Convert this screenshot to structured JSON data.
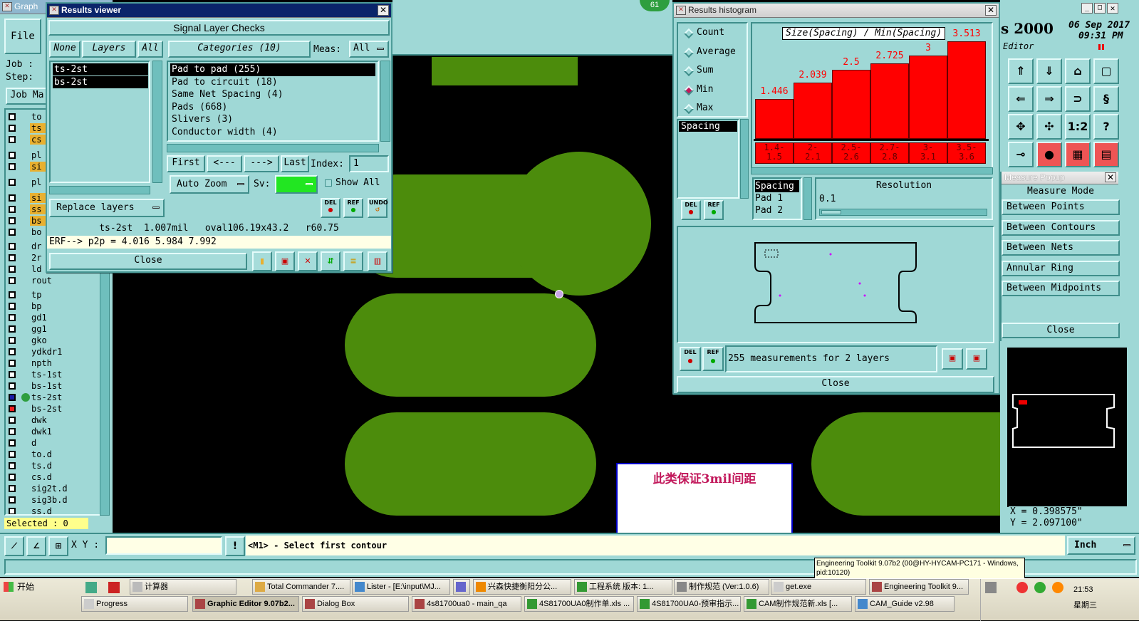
{
  "graphic_editor": {
    "title": "Graph",
    "file_menu": "File",
    "job_label": "Job :",
    "step_label": "Step:",
    "job_manager_btn": "Job Ma",
    "right_header_num": "s 2000",
    "right_header_date": "06 Sep 2017",
    "right_header_time": "09:31 PM",
    "editor_label": "Editor",
    "badge": "61"
  },
  "layers": [
    {
      "name": "to",
      "color": "#9fd8d6"
    },
    {
      "name": "ts",
      "color": "#e8b030"
    },
    {
      "name": "cs",
      "color": "#e8b030"
    },
    {
      "name": "pl",
      "color": "#9fd8d6"
    },
    {
      "name": "si",
      "color": "#e8b030"
    },
    {
      "name": "pl",
      "color": "#9fd8d6"
    },
    {
      "name": "si",
      "color": "#e8b030"
    },
    {
      "name": "ss",
      "color": "#e8b030"
    },
    {
      "name": "bs",
      "color": "#e8b030"
    },
    {
      "name": "bo",
      "color": "#9fd8d6"
    },
    {
      "name": "dr",
      "color": "#9fd8d6"
    },
    {
      "name": "2r",
      "color": "#9fd8d6"
    },
    {
      "name": "ld",
      "color": "#9fd8d6"
    },
    {
      "name": "rout",
      "color": "#9fd8d6"
    },
    {
      "name": "tp",
      "color": "#9fd8d6"
    },
    {
      "name": "bp",
      "color": "#9fd8d6"
    },
    {
      "name": "gd1",
      "color": "#9fd8d6"
    },
    {
      "name": "gg1",
      "color": "#9fd8d6"
    },
    {
      "name": "gko",
      "color": "#9fd8d6"
    },
    {
      "name": "ydkdr1",
      "color": "#9fd8d6"
    },
    {
      "name": "npth",
      "color": "#9fd8d6"
    },
    {
      "name": "ts-1st",
      "color": "#9fd8d6"
    },
    {
      "name": "bs-1st",
      "color": "#9fd8d6"
    },
    {
      "name": "ts-2st",
      "color": "#9fd8d6"
    },
    {
      "name": "bs-2st",
      "color": "#9fd8d6"
    },
    {
      "name": "dwk",
      "color": "#9fd8d6"
    },
    {
      "name": "dwk1",
      "color": "#9fd8d6"
    },
    {
      "name": "d",
      "color": "#9fd8d6"
    },
    {
      "name": "to.d",
      "color": "#9fd8d6"
    },
    {
      "name": "ts.d",
      "color": "#9fd8d6"
    },
    {
      "name": "cs.d",
      "color": "#9fd8d6"
    },
    {
      "name": "sig2t.d",
      "color": "#9fd8d6"
    },
    {
      "name": "sig3b.d",
      "color": "#9fd8d6"
    },
    {
      "name": "ss.d",
      "color": "#9fd8d6"
    }
  ],
  "selected_label": "Selected : 0",
  "results_viewer": {
    "title": "Results viewer",
    "header": "Signal Layer Checks",
    "none_btn": "None",
    "layers_btn": "Layers",
    "all_btn": "All",
    "categories_label": "Categories (10)",
    "meas_label": "Meas:",
    "meas_value": "All",
    "layer_items": [
      "ts-2st",
      "bs-2st"
    ],
    "category_items": [
      "Pad to pad (255)",
      "Pad to circuit (18)",
      "Same Net Spacing (4)",
      "Pads (668)",
      "Slivers (3)",
      "Conductor width (4)"
    ],
    "first_btn": "First",
    "prev_btn": "<---",
    "next_btn": "--->",
    "last_btn": "Last",
    "index_label": "Index:",
    "index_value": "1",
    "auto_zoom": "Auto Zoom",
    "sv_label": "Sv:",
    "show_all": "Show All",
    "replace_layers": "Replace layers",
    "del": "DEL",
    "ref": "REF",
    "undo": "UNDO",
    "info_line": "ts-2st  1.007mil   oval106.19x43.2   r60.75",
    "erf_line": "ERF--> p2p = 4.016 5.984 7.992",
    "close": "Close"
  },
  "histogram": {
    "title": "Results histogram",
    "modes": [
      {
        "label": "Count",
        "on": false
      },
      {
        "label": "Average",
        "on": false
      },
      {
        "label": "Sum",
        "on": false
      },
      {
        "label": "Min",
        "on": true
      },
      {
        "label": "Max",
        "on": false
      }
    ],
    "list_item": "Spacing",
    "chart_title": "Size(Spacing) / Min(Spacing)",
    "chart_data": {
      "type": "bar",
      "categories": [
        "1.4-1.5",
        "2-2.1",
        "2.5-2.6",
        "2.7-2.8",
        "3-3.1",
        "3.5-3.6"
      ],
      "values": [
        1.446,
        2.039,
        2.5,
        2.725,
        3,
        3.513
      ],
      "value_labels": [
        "1.446",
        "2.039",
        "2.5",
        "2.725",
        "3",
        "3.513"
      ],
      "bin_line1": [
        "1.4-",
        "2-",
        "2.5-",
        "2.7-",
        "3-",
        "3.5-"
      ],
      "bin_line2": [
        "1.5",
        "2.1",
        "2.6",
        "2.8",
        "3.1",
        "3.6"
      ],
      "ylim": [
        0,
        3.6
      ]
    },
    "info_list": [
      "Spacing",
      "Pad 1",
      "Pad 2"
    ],
    "resolution_label": "Resolution",
    "resolution_value": "0.1",
    "measurements": "255 measurements for 2 layers",
    "close": "Close"
  },
  "measure_popup": {
    "title": "Measure Popup",
    "mode_label": "Measure Mode",
    "modes": [
      "Between Points",
      "Between Contours",
      "Between Nets",
      "Annular Ring",
      "Between Midpoints"
    ],
    "close": "Close"
  },
  "coords": {
    "x": "X = 0.398575\"",
    "y": "Y = 2.097100\""
  },
  "annotation": "此类保证3mil间距",
  "bottom": {
    "xy_label": "X Y :",
    "prompt": "<M1> - Select first contour",
    "units": "Inch"
  },
  "tooltip": "Engineering Toolkit 9.07b2 (00@HY-HYCAM-PC171 - Windows, pid:10120)",
  "taskbar": {
    "start": "开始",
    "row1": [
      "计算器",
      "Total Commander 7....",
      "Lister - [E:\\input\\MJ...",
      "",
      "兴森快捷衡阳分公...",
      "工程系统  版本: 1...",
      "制作规范 (Ver:1.0.6)",
      "get.exe",
      "Engineering Toolkit 9..."
    ],
    "row2": [
      "Progress",
      "Graphic Editor 9.07b2...",
      "Dialog Box",
      "4s81700ua0 - main_qa",
      "4S81700UA0制作单.xls ...",
      "4S81700UA0-预审指示...",
      "CAM制作规范新.xls  [...",
      "CAM_Guide v2.98"
    ],
    "clock": "21:53",
    "weekday": "星期三"
  }
}
